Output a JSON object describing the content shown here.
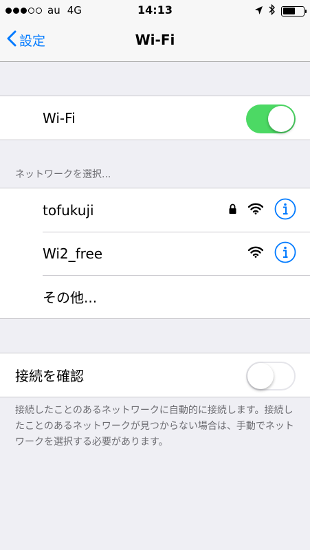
{
  "status_bar": {
    "carrier": "au",
    "network": "4G",
    "time": "14:13"
  },
  "nav": {
    "back_label": "設定",
    "title": "Wi-Fi"
  },
  "wifi_row": {
    "label": "Wi-Fi",
    "enabled": true
  },
  "networks_header": "ネットワークを選択...",
  "networks": [
    {
      "name": "tofukuji",
      "locked": true
    },
    {
      "name": "Wi2_free",
      "locked": false
    },
    {
      "name": "その他..."
    }
  ],
  "ask_join": {
    "label": "接続を確認",
    "enabled": false
  },
  "footer": "接続したことのあるネットワークに自動的に接続します。接続したことのあるネットワークが見つからない場合は、手動でネットワークを選択する必要があります。",
  "colors": {
    "accent": "#007aff",
    "toggle_on": "#4cd964",
    "background": "#efeff4"
  },
  "icons": [
    "location-arrow-icon",
    "bluetooth-icon",
    "battery-icon",
    "chevron-left-icon",
    "lock-icon",
    "wifi-icon",
    "info-icon"
  ]
}
